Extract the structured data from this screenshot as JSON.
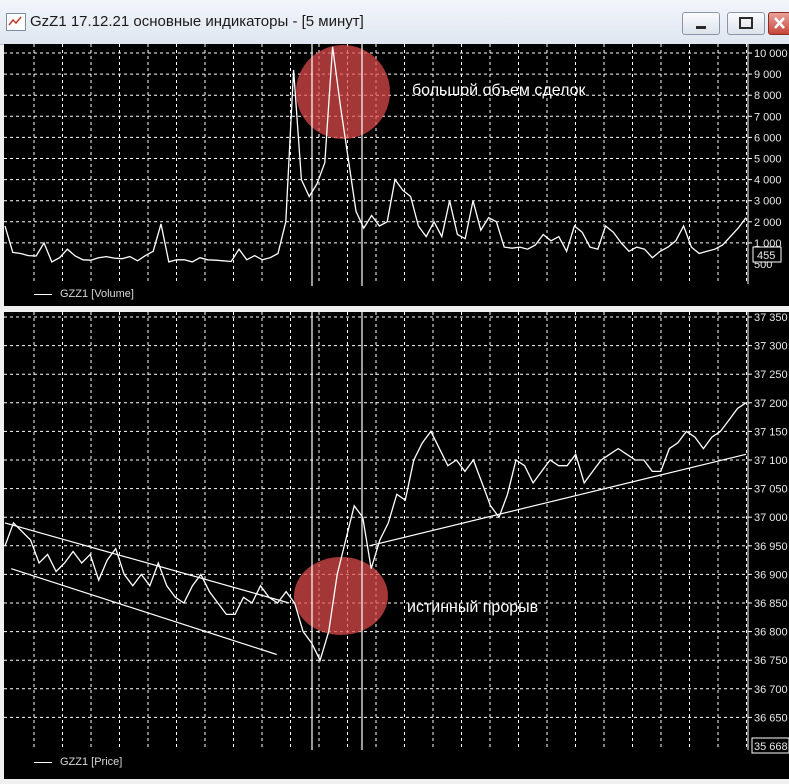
{
  "window": {
    "title": "GzZ1 17.12.21 основные индикаторы - [5 минут]",
    "buttons": [
      "minimize",
      "maximize",
      "close"
    ]
  },
  "volume_panel": {
    "legend": "GZZ1 [Volume]",
    "annotation": "большой объем сделок",
    "y_ticks": [
      "10 000",
      "9 000",
      "8 000",
      "7 000",
      "6 000",
      "5 000",
      "4 000",
      "3 000",
      "2 000",
      "1 000",
      "500"
    ],
    "current_value": "455",
    "series": [
      1800,
      550,
      500,
      400,
      380,
      1000,
      100,
      300,
      700,
      380,
      200,
      180,
      300,
      350,
      280,
      250,
      350,
      150,
      400,
      600,
      1900,
      100,
      200,
      200,
      100,
      300,
      200,
      180,
      150,
      120,
      700,
      200,
      400,
      200,
      300,
      500,
      2000,
      9200,
      4000,
      3200,
      3800,
      4800,
      10300,
      7500,
      5000,
      2500,
      1700,
      2300,
      1800,
      2000,
      4000,
      3500,
      3200,
      1800,
      1300,
      2000,
      1300,
      3000,
      1400,
      1200,
      3000,
      1600,
      2200,
      2000,
      800,
      750,
      800,
      700,
      900,
      1400,
      1100,
      1300,
      600,
      1800,
      1500,
      800,
      700,
      1800,
      1500,
      1000,
      600,
      800,
      700,
      300,
      600,
      800,
      1100,
      1800,
      800,
      500,
      600,
      700,
      900,
      1300,
      1700,
      2200
    ]
  },
  "price_panel": {
    "legend": "GZZ1 [Price]",
    "annotation": "истинный прорыв",
    "y_ticks": [
      "37 350",
      "37 300",
      "37 250",
      "37 200",
      "37 150",
      "37 100",
      "37 050",
      "37 000",
      "36 950",
      "36 900",
      "36 850",
      "36 800",
      "36 750",
      "36 700",
      "36 650"
    ],
    "current_value": "35 668",
    "series": [
      36950,
      36990,
      36975,
      36960,
      36920,
      36935,
      36905,
      36920,
      36940,
      36920,
      36935,
      36890,
      36925,
      36945,
      36900,
      36880,
      36900,
      36880,
      36920,
      36880,
      36860,
      36850,
      36880,
      36900,
      36870,
      36850,
      36830,
      36830,
      36860,
      36850,
      36880,
      36860,
      36850,
      36870,
      36850,
      36800,
      36780,
      36750,
      36800,
      36900,
      36960,
      37020,
      37000,
      36910,
      36960,
      36990,
      37040,
      37030,
      37100,
      37130,
      37150,
      37120,
      37090,
      37100,
      37080,
      37100,
      37060,
      37020,
      37000,
      37040,
      37100,
      37090,
      37060,
      37080,
      37100,
      37090,
      37090,
      37110,
      37060,
      37080,
      37100,
      37110,
      37120,
      37110,
      37100,
      37100,
      37080,
      37080,
      37120,
      37130,
      37150,
      37140,
      37120,
      37140,
      37150,
      37170,
      37190,
      37200
    ],
    "trendlines": [
      {
        "from": [
          0,
          36990
        ],
        "to": [
          46,
          36850
        ]
      },
      {
        "from": [
          1,
          36910
        ],
        "to": [
          44,
          36760
        ]
      },
      {
        "from": [
          59,
          36950
        ],
        "to": [
          120,
          37110
        ]
      }
    ]
  }
}
